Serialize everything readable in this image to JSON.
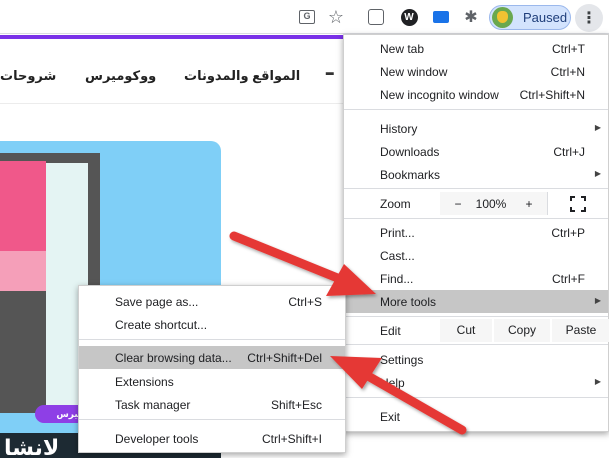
{
  "toolbar": {
    "profile_status": "Paused",
    "wordpress_icon_letter": "W"
  },
  "page": {
    "logo_fragment": "ـ",
    "nav": {
      "sites": "المواقع والمدونات",
      "woocommerce": "ووكوميرس",
      "tutorials": "شروحات"
    },
    "hero": {
      "label": "ميرس",
      "title": "لانشا"
    }
  },
  "main_menu": {
    "new_tab": {
      "label": "New tab",
      "shortcut": "Ctrl+T"
    },
    "new_window": {
      "label": "New window",
      "shortcut": "Ctrl+N"
    },
    "new_incognito": {
      "label": "New incognito window",
      "shortcut": "Ctrl+Shift+N"
    },
    "history": {
      "label": "History"
    },
    "downloads": {
      "label": "Downloads",
      "shortcut": "Ctrl+J"
    },
    "bookmarks": {
      "label": "Bookmarks"
    },
    "zoom": {
      "label": "Zoom",
      "minus": "−",
      "level": "100%",
      "plus": "+"
    },
    "print": {
      "label": "Print...",
      "shortcut": "Ctrl+P"
    },
    "cast": {
      "label": "Cast..."
    },
    "find": {
      "label": "Find...",
      "shortcut": "Ctrl+F"
    },
    "more_tools": {
      "label": "More tools"
    },
    "edit": {
      "label": "Edit",
      "cut": "Cut",
      "copy": "Copy",
      "paste": "Paste"
    },
    "settings": {
      "label": "Settings"
    },
    "help": {
      "label": "Help"
    },
    "exit": {
      "label": "Exit"
    }
  },
  "more_tools_menu": {
    "save_page": {
      "label": "Save page as...",
      "shortcut": "Ctrl+S"
    },
    "create_shortcut": {
      "label": "Create shortcut..."
    },
    "clear_browsing": {
      "label": "Clear browsing data...",
      "shortcut": "Ctrl+Shift+Del"
    },
    "extensions": {
      "label": "Extensions"
    },
    "task_manager": {
      "label": "Task manager",
      "shortcut": "Shift+Esc"
    },
    "developer_tools": {
      "label": "Developer tools",
      "shortcut": "Ctrl+Shift+I"
    }
  },
  "colors": {
    "accent_purple": "#7a31e8",
    "arrow_red": "#e53935",
    "menu_highlight": "#c6c6c6"
  }
}
